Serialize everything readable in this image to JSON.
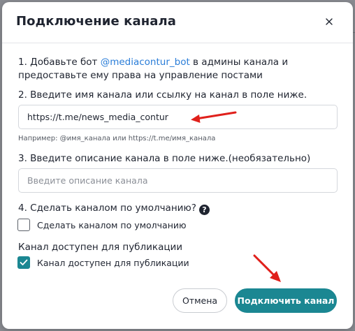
{
  "modal": {
    "title": "Подключение канала",
    "close_icon": "close-icon"
  },
  "steps": {
    "step1_prefix": "1. Добавьте бот ",
    "step1_link": "@mediacontur_bot",
    "step1_suffix": " в админы канала и",
    "step1_line2": "предоставьте ему права на управление постами",
    "step2": "2. Введите имя канала или ссылку на канал в поле ниже.",
    "step3": "3. Введите описание канала в поле ниже.(необязательно)",
    "step4": "4. Сделать каналом по умолчанию?",
    "step5": "Канал доступен для публикации"
  },
  "channel_input": {
    "value": "https://t.me/news_media_contur",
    "hint": "Например: @имя_канала или https://t.me/имя_канала"
  },
  "description_input": {
    "placeholder": "Введите описание канала"
  },
  "checkboxes": {
    "default_label": "Сделать каналом по умолчанию",
    "default_checked": false,
    "available_label": "Канал доступен для публикации",
    "available_checked": true
  },
  "buttons": {
    "cancel": "Отмена",
    "submit": "Подключить канал"
  },
  "colors": {
    "accent": "#1b8792",
    "link": "#2a7dd8",
    "arrow": "#e0201b"
  }
}
